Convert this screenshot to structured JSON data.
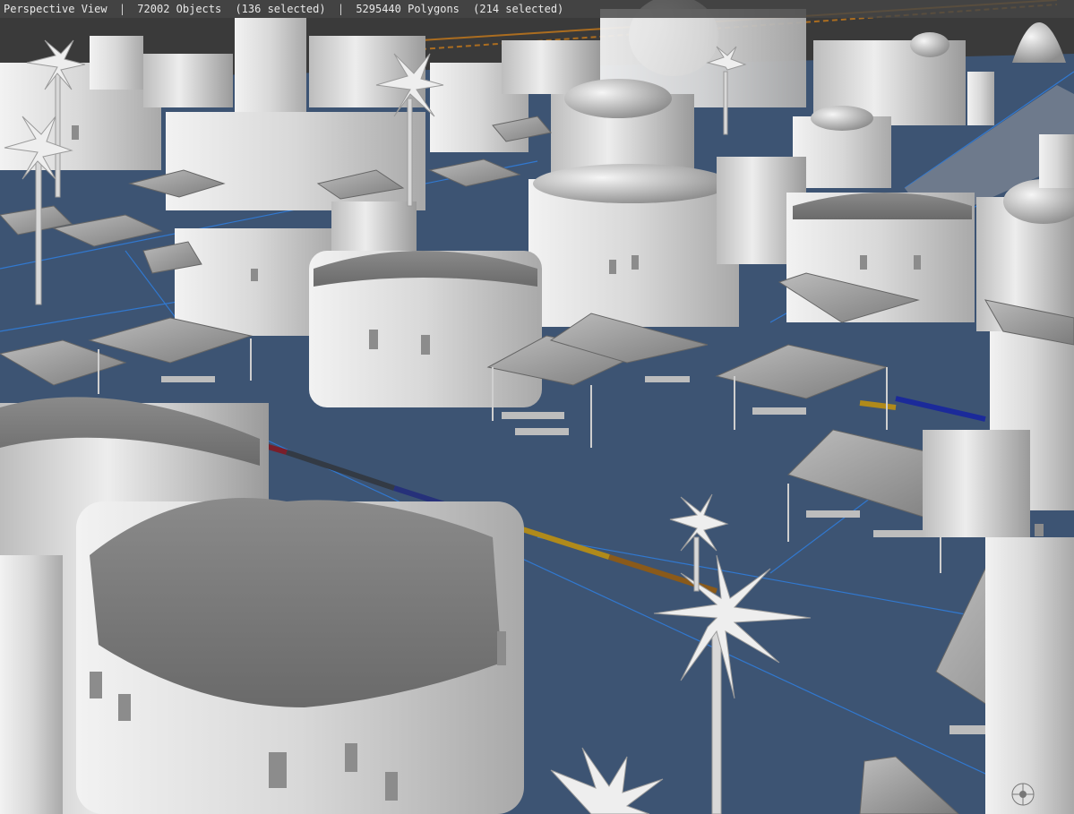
{
  "viewport": {
    "view_name": "Perspective View",
    "objects": "72002 Objects",
    "objects_selected": "(136 selected)",
    "polygons": "5295440 Polygons",
    "polygons_selected": "(214 selected)",
    "separator": "|"
  },
  "colors": {
    "ground": "#3d5473",
    "grid": "#2f7fe0",
    "model": "#d9d9d9",
    "model_shadow": "#9c9c9c",
    "model_dark": "#6f6f6f",
    "roof": "#7a7a7a",
    "hud_bg": "#464646",
    "hud_text": "#e8e8e8",
    "road_accent_red": "#7a1e2a",
    "road_accent_yellow": "#b08a1a",
    "road_accent_blue": "#1b2a9a",
    "background_sky": "#3a3a3a"
  },
  "scene": {
    "description_icon": "market-town-3d-model-icon",
    "gizmo_icon": "navigation-gizmo-icon"
  }
}
